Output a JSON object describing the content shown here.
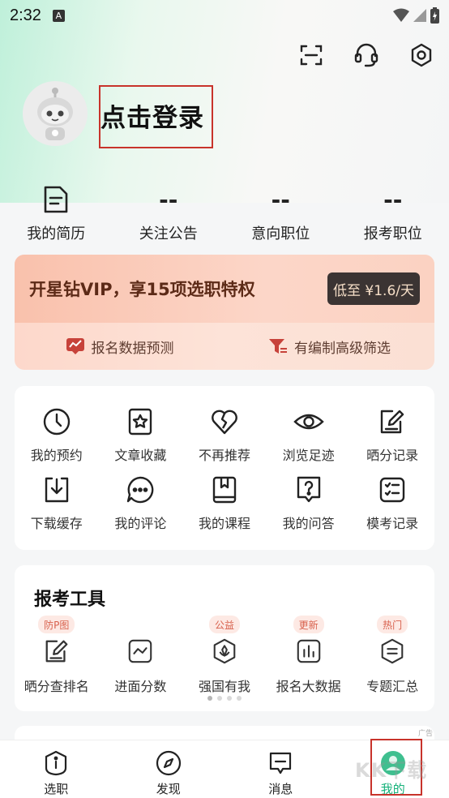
{
  "status": {
    "time": "2:32",
    "notif": "A"
  },
  "header": {
    "login_label": "点击登录",
    "icons": [
      "scan-icon",
      "headset-icon",
      "settings-icon"
    ]
  },
  "stats": [
    {
      "value": "",
      "label": "我的简历",
      "icon": "resume-icon"
    },
    {
      "value": "--",
      "label": "关注公告"
    },
    {
      "value": "--",
      "label": "意向职位"
    },
    {
      "value": "--",
      "label": "报考职位"
    }
  ],
  "vip": {
    "title": "开星钻VIP，享15项选职特权",
    "price": "低至 ¥1.6/天",
    "features": [
      "报名数据预测",
      "有编制高级筛选"
    ]
  },
  "grid": [
    {
      "label": "我的预约",
      "icon": "clock-icon"
    },
    {
      "label": "文章收藏",
      "icon": "star-bookmark-icon"
    },
    {
      "label": "不再推荐",
      "icon": "broken-heart-icon"
    },
    {
      "label": "浏览足迹",
      "icon": "eye-icon"
    },
    {
      "label": "晒分记录",
      "icon": "edit-note-icon"
    },
    {
      "label": "下载缓存",
      "icon": "download-icon"
    },
    {
      "label": "我的评论",
      "icon": "comment-icon"
    },
    {
      "label": "我的课程",
      "icon": "course-book-icon"
    },
    {
      "label": "我的问答",
      "icon": "question-icon"
    },
    {
      "label": "模考记录",
      "icon": "checklist-icon"
    }
  ],
  "tools": {
    "title": "报考工具",
    "items": [
      {
        "label": "晒分查排名",
        "tag": "防P图",
        "icon": "edit-score-icon"
      },
      {
        "label": "进面分数",
        "tag": "",
        "icon": "trend-icon"
      },
      {
        "label": "强国有我",
        "tag": "公益",
        "icon": "emblem-icon"
      },
      {
        "label": "报名大数据",
        "tag": "更新",
        "icon": "bar-chart-icon"
      },
      {
        "label": "专题汇总",
        "tag": "热门",
        "icon": "topic-icon"
      }
    ]
  },
  "peek": {
    "ad": "广告"
  },
  "tabbar": [
    {
      "label": "选职",
      "icon": "info-shield-icon"
    },
    {
      "label": "发现",
      "icon": "compass-icon"
    },
    {
      "label": "消息",
      "icon": "message-icon"
    },
    {
      "label": "我的",
      "icon": "profile-icon",
      "active": true
    }
  ],
  "watermark": "KK下载",
  "colors": {
    "accent": "#17b27b",
    "highlight_box": "#c8332b",
    "vip_text": "#5c2a17"
  }
}
